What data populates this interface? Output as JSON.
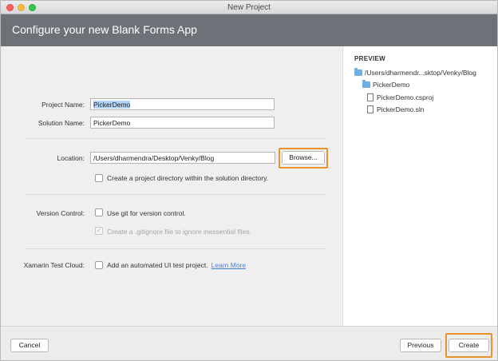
{
  "window": {
    "title": "New Project"
  },
  "header": {
    "title": "Configure your new Blank Forms App"
  },
  "form": {
    "project_name_label": "Project Name:",
    "project_name_value": "PickerDemo",
    "solution_name_label": "Solution Name:",
    "solution_name_value": "PickerDemo",
    "location_label": "Location:",
    "location_value": "/Users/dharmendra/Desktop/Venky/Blog",
    "browse_label": "Browse...",
    "create_dir_label": "Create a project directory within the solution directory.",
    "version_control_label": "Version Control:",
    "use_git_label": "Use git for version control.",
    "gitignore_label": "Create a .gitignore file to ignore inessential files.",
    "test_cloud_label": "Xamarin Test Cloud:",
    "ui_test_label": "Add an automated UI test project.",
    "learn_more_label": "Learn More"
  },
  "preview": {
    "heading": "PREVIEW",
    "root": "/Users/dharmendr...sktop/Venky/Blog",
    "folder": "PickerDemo",
    "file_csproj": "PickerDemo.csproj",
    "file_sln": "PickerDemo.sln"
  },
  "footer": {
    "cancel_label": "Cancel",
    "previous_label": "Previous",
    "create_label": "Create"
  },
  "colors": {
    "header_bg": "#6d7278",
    "highlight": "#e8932e",
    "folder": "#6fb0e0",
    "link": "#4a7fd6"
  }
}
